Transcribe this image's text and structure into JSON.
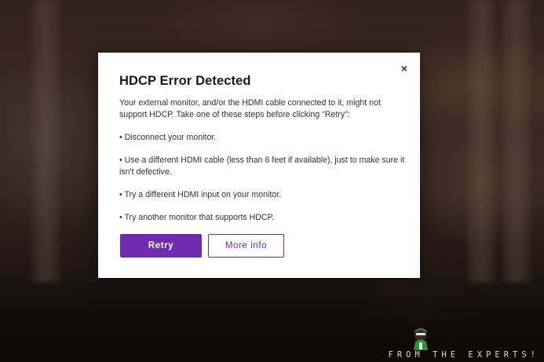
{
  "dialog": {
    "title": "HDCP Error Detected",
    "close_glyph": "×",
    "intro": "Your external monitor, and/or the HDMI cable connected to it, might not support HDCP. Take one of these steps before clicking \"Retry\":",
    "steps": [
      "• Disconnect your monitor.",
      "• Use a different HDMI cable (less than 6 feet if available), just to make sure it isn't defective.",
      "• Try a different HDMI input on your monitor.",
      "• Try another monitor that supports HDCP."
    ],
    "retry_label": "Retry",
    "more_info_label": "More info"
  },
  "watermark": {
    "text": "FROM THE EXPERTS!"
  },
  "colors": {
    "accent": "#6c2bb0",
    "dialog_bg": "#ffffff",
    "title": "#1a1a1a",
    "body_text": "#333333"
  },
  "icons": {
    "close": "close-icon",
    "watermark_logo": "mascot-logo-icon"
  }
}
